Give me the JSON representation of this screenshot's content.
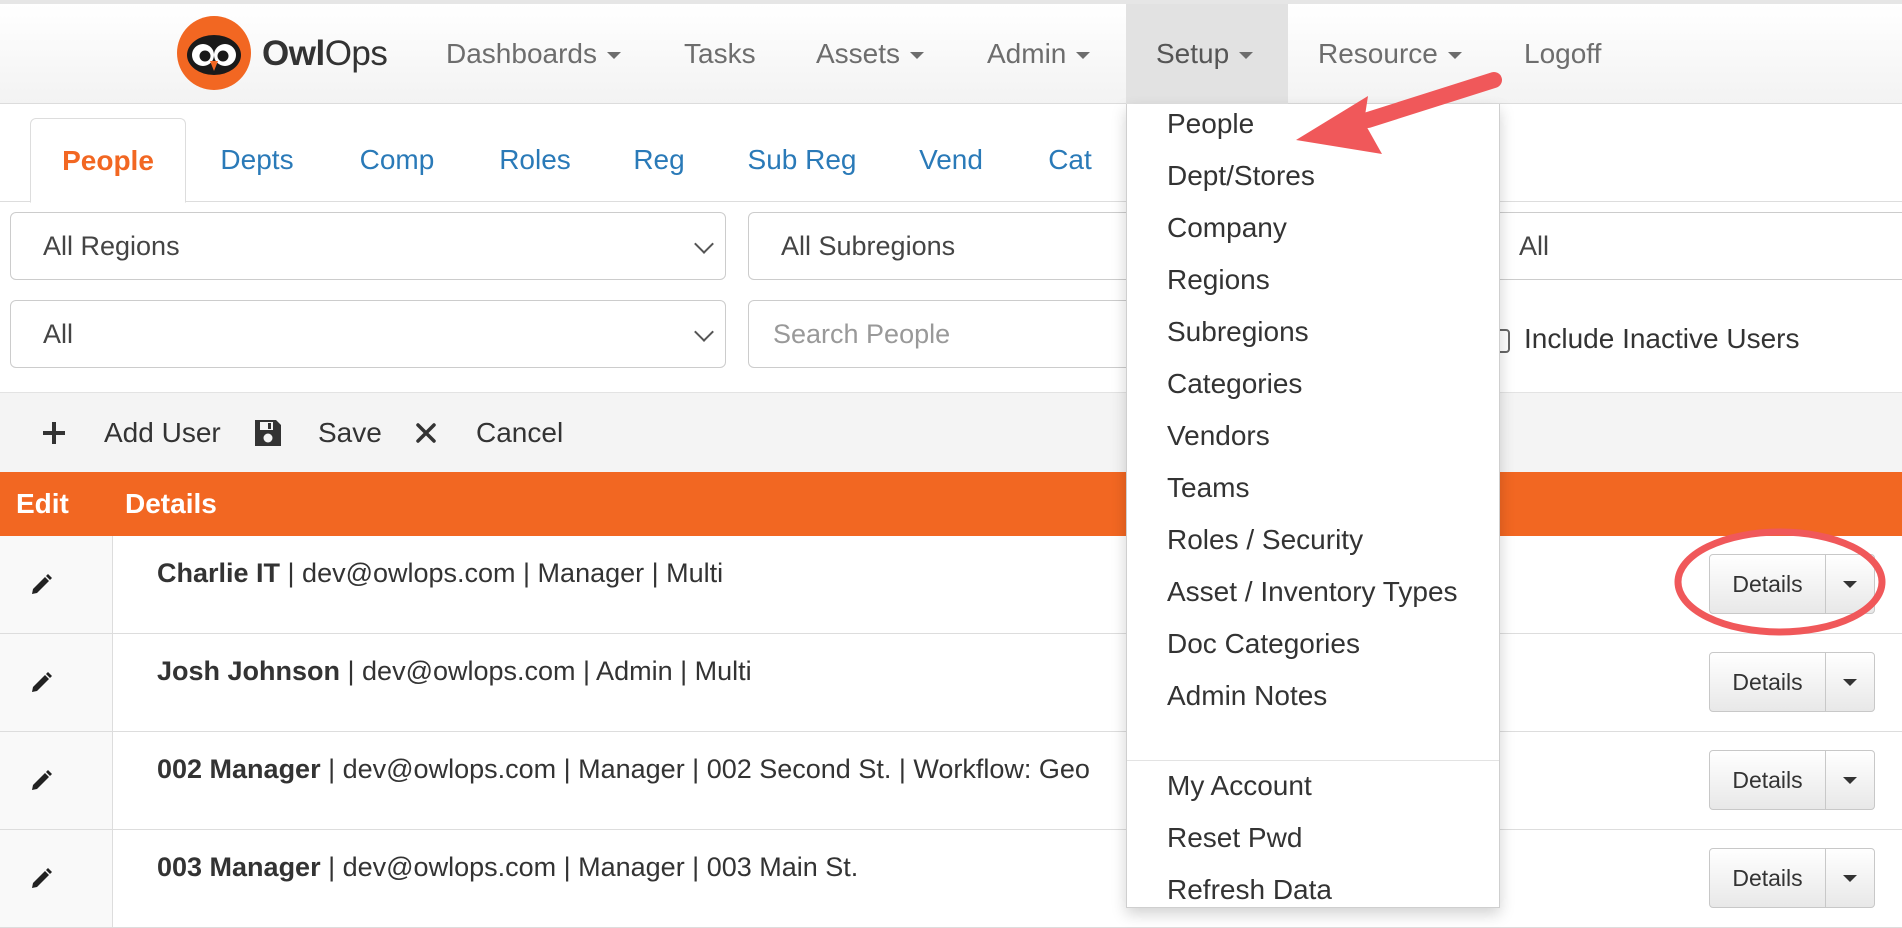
{
  "brand": {
    "name_bold": "Owl",
    "name_rest": "Ops"
  },
  "nav": {
    "items": [
      {
        "label": "Dashboards"
      },
      {
        "label": "Tasks"
      },
      {
        "label": "Assets"
      },
      {
        "label": "Admin"
      },
      {
        "label": "Setup"
      },
      {
        "label": "Resource"
      },
      {
        "label": "Logoff"
      }
    ]
  },
  "tabs": [
    {
      "label": "People"
    },
    {
      "label": "Depts"
    },
    {
      "label": "Comp"
    },
    {
      "label": "Roles"
    },
    {
      "label": "Reg"
    },
    {
      "label": "Sub Reg"
    },
    {
      "label": "Vend"
    },
    {
      "label": "Cat"
    }
  ],
  "filters": {
    "region": "All Regions",
    "subregion": "All Subregions",
    "third": "All",
    "role": "All",
    "search_placeholder": "Search People",
    "include_inactive_label": "Include Inactive Users"
  },
  "toolbar": {
    "add_label": "Add User",
    "save_label": "Save",
    "cancel_label": "Cancel"
  },
  "grid": {
    "headers": {
      "edit": "Edit",
      "details": "Details"
    },
    "rows": [
      {
        "name": "Charlie IT",
        "info": " | dev@owlops.com | Manager | Multi",
        "button": "Details"
      },
      {
        "name": "Josh Johnson",
        "info": " | dev@owlops.com | Admin | Multi",
        "button": "Details"
      },
      {
        "name": "002 Manager",
        "info": " | dev@owlops.com | Manager | 002 Second St. | Workflow: Geo",
        "button": "Details"
      },
      {
        "name": "003 Manager",
        "info": " | dev@owlops.com | Manager | 003 Main St.",
        "button": "Details"
      }
    ]
  },
  "setup_menu": {
    "items": [
      "People",
      "Dept/Stores",
      "Company",
      "Regions",
      "Subregions",
      "Categories",
      "Vendors",
      "Teams",
      "Roles / Security",
      "Asset / Inventory Types",
      "Doc Categories",
      "Admin Notes"
    ],
    "account_items": [
      "My Account",
      "Reset Pwd",
      "Refresh Data"
    ]
  },
  "colors": {
    "accent": "#f26722",
    "link": "#2a7ab8",
    "annotation": "#f0585a"
  }
}
